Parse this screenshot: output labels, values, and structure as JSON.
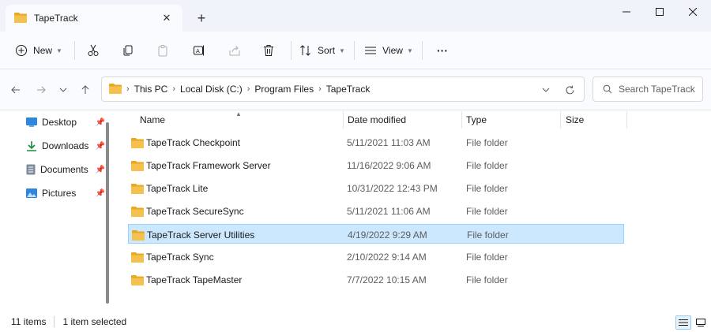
{
  "window": {
    "tab_title": "TapeTrack",
    "new_tab_symbol": "+",
    "close_tab_symbol": "✕"
  },
  "toolbar": {
    "new_label": "New",
    "sort_label": "Sort",
    "view_label": "View",
    "more_symbol": "···"
  },
  "address": {
    "breadcrumbs": [
      "This PC",
      "Local Disk (C:)",
      "Program Files",
      "TapeTrack"
    ]
  },
  "search": {
    "placeholder": "Search TapeTrack"
  },
  "sidebar": {
    "items": [
      {
        "label": "Desktop",
        "icon": "desktop-icon"
      },
      {
        "label": "Downloads",
        "icon": "download-icon"
      },
      {
        "label": "Documents",
        "icon": "document-icon"
      },
      {
        "label": "Pictures",
        "icon": "pictures-icon"
      }
    ]
  },
  "columns": {
    "name": "Name",
    "date": "Date modified",
    "type": "Type",
    "size": "Size"
  },
  "files": [
    {
      "name": "TapeTrack Checkpoint",
      "date": "5/11/2021 11:03 AM",
      "type": "File folder"
    },
    {
      "name": "TapeTrack Framework Server",
      "date": "11/16/2022 9:06 AM",
      "type": "File folder"
    },
    {
      "name": "TapeTrack Lite",
      "date": "10/31/2022 12:43 PM",
      "type": "File folder"
    },
    {
      "name": "TapeTrack SecureSync",
      "date": "5/11/2021 11:06 AM",
      "type": "File folder"
    },
    {
      "name": "TapeTrack Server Utilities",
      "date": "4/19/2022 9:29 AM",
      "type": "File folder"
    },
    {
      "name": "TapeTrack Sync",
      "date": "2/10/2022 9:14 AM",
      "type": "File folder"
    },
    {
      "name": "TapeTrack TapeMaster",
      "date": "7/7/2022 10:15 AM",
      "type": "File folder"
    }
  ],
  "selected_index": 4,
  "status": {
    "item_count": "11 items",
    "selection": "1 item selected"
  },
  "colors": {
    "folder": "#f4c04e",
    "folder_dark": "#e8a820",
    "selection_bg": "#cce8ff",
    "selection_border": "#99d1ff",
    "accent": "#0067c0"
  }
}
